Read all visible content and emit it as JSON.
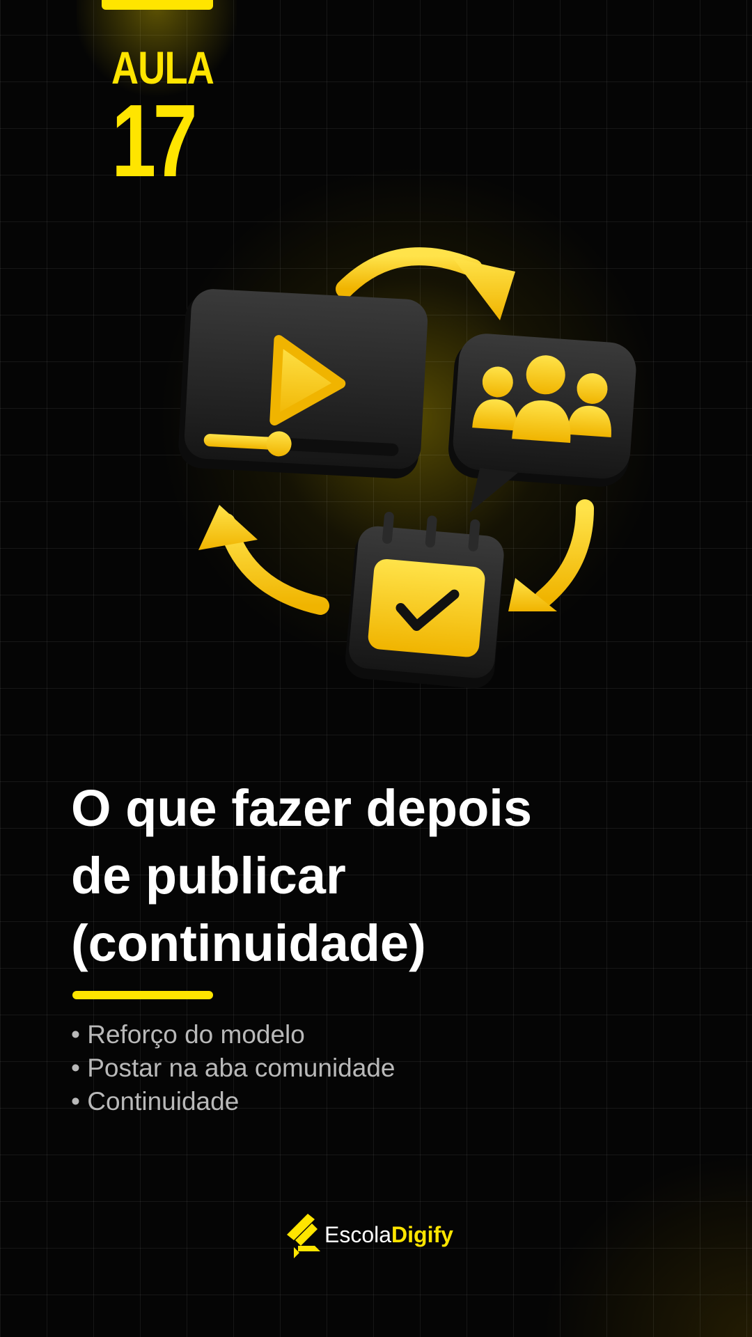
{
  "lesson": {
    "label": "AULA",
    "number": "17"
  },
  "title_lines": [
    "O que fazer depois",
    "de publicar",
    "(continuidade)"
  ],
  "bullets": [
    "• Reforço do modelo",
    "• Postar na aba comunidade",
    "• Continuidade"
  ],
  "brand": {
    "part1": "Escola",
    "part2": "Digify"
  },
  "colors": {
    "accent": "#ffe500",
    "background": "#050505",
    "text": "#ffffff",
    "muted": "#b9b9b9"
  },
  "icons": [
    "video-player-icon",
    "community-chat-icon",
    "calendar-check-icon",
    "cycle-arrow-icon",
    "escola-digify-logo-icon"
  ]
}
